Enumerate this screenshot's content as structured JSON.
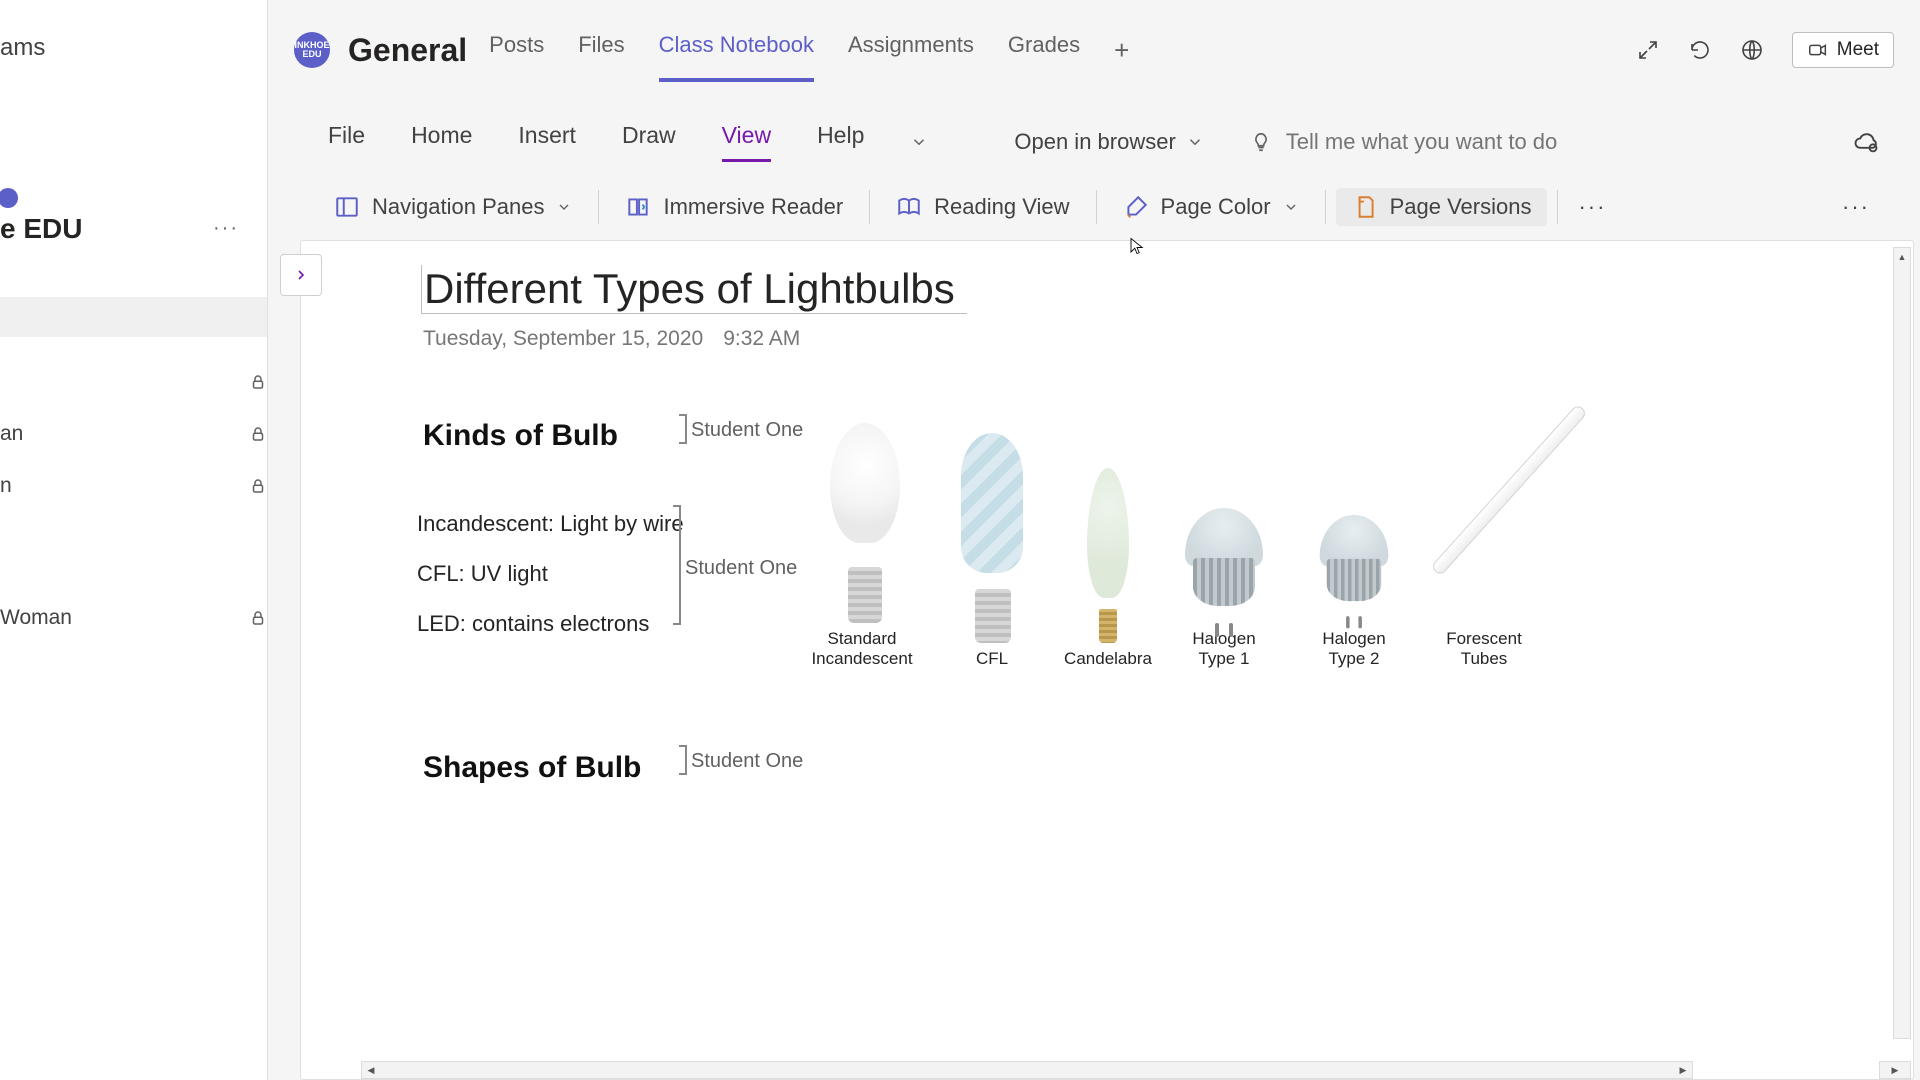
{
  "leftPanel": {
    "head": "ams",
    "title": "e EDU",
    "items": [
      {
        "label": ""
      },
      {
        "label": "an"
      },
      {
        "label": "n"
      },
      {
        "label": "Woman"
      }
    ]
  },
  "channel": {
    "name": "General",
    "avatar_text": "INKHOE EDU",
    "tabs": [
      {
        "label": "Posts"
      },
      {
        "label": "Files"
      },
      {
        "label": "Class Notebook",
        "active": true
      },
      {
        "label": "Assignments"
      },
      {
        "label": "Grades"
      }
    ],
    "meet_label": "Meet"
  },
  "ribbon": {
    "tabs": [
      {
        "label": "File"
      },
      {
        "label": "Home"
      },
      {
        "label": "Insert"
      },
      {
        "label": "Draw"
      },
      {
        "label": "View",
        "active": true
      },
      {
        "label": "Help"
      }
    ],
    "open_in_browser": "Open in browser",
    "tellme_placeholder": "Tell me what you want to do"
  },
  "toolbar": {
    "nav_panes": "Navigation Panes",
    "immersive": "Immersive Reader",
    "reading_view": "Reading View",
    "page_color": "Page Color",
    "page_versions": "Page Versions"
  },
  "doc": {
    "title": "Different Types of Lightbulbs",
    "date": "Tuesday, September 15, 2020",
    "time": "9:32 AM",
    "section1_heading": "Kinds of Bulb",
    "section2_heading": "Shapes of Bulb",
    "bullets": [
      "Incandescent: Light by wire",
      "CFL: UV light",
      "LED: contains electrons"
    ],
    "author_tag1": "Student One",
    "author_tag2": "Student One",
    "author_tag3": "Student One",
    "bulbs": [
      "Standard Incandescent",
      "CFL",
      "Candelabra",
      "Halogen Type 1",
      "Halogen Type 2",
      "Forescent Tubes"
    ]
  }
}
